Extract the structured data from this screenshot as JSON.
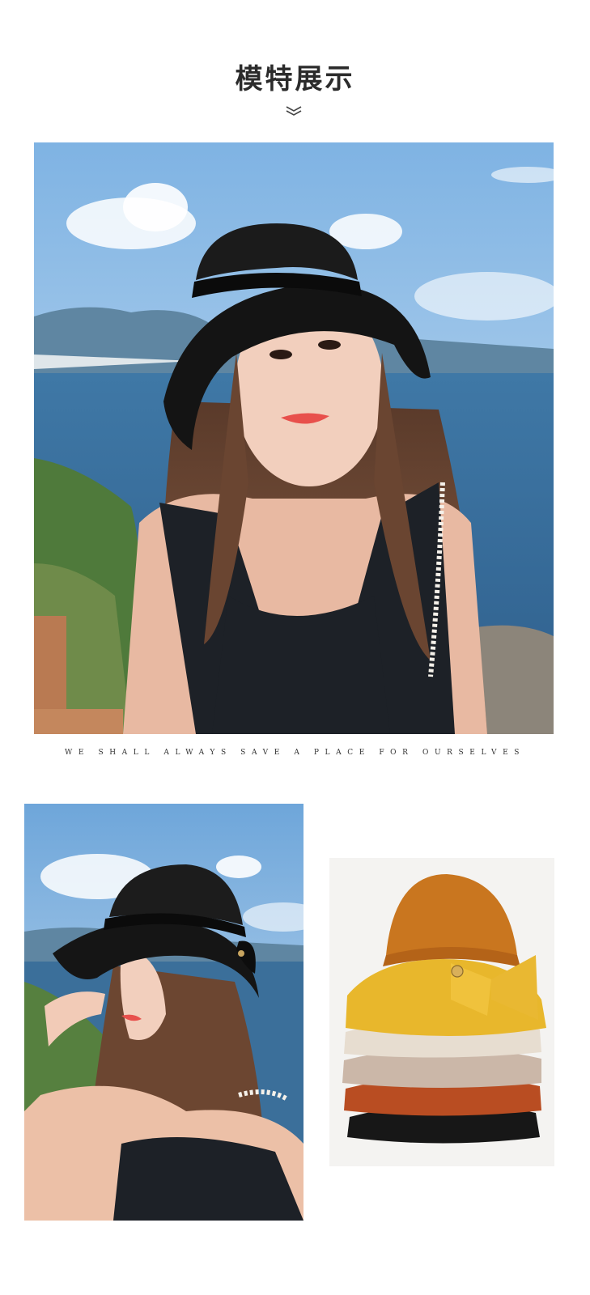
{
  "section_title": "模特展示",
  "tagline": "WE SHALL ALWAYS SAVE A PLACE FOR OURSELVES",
  "icons": {
    "divider": "double-chevron-down-icon"
  },
  "photos": {
    "main": "model-portrait-photo",
    "side": "model-side-photo",
    "product": "hat-stack-product-photo"
  },
  "colors": {
    "title": "#2b2b2b",
    "hat_black": "#141414",
    "hat_yellow": "#e8b72c",
    "hat_orange_crown": "#c9761f",
    "sea": "#3c6f99",
    "sky": "#9cc6ea"
  }
}
